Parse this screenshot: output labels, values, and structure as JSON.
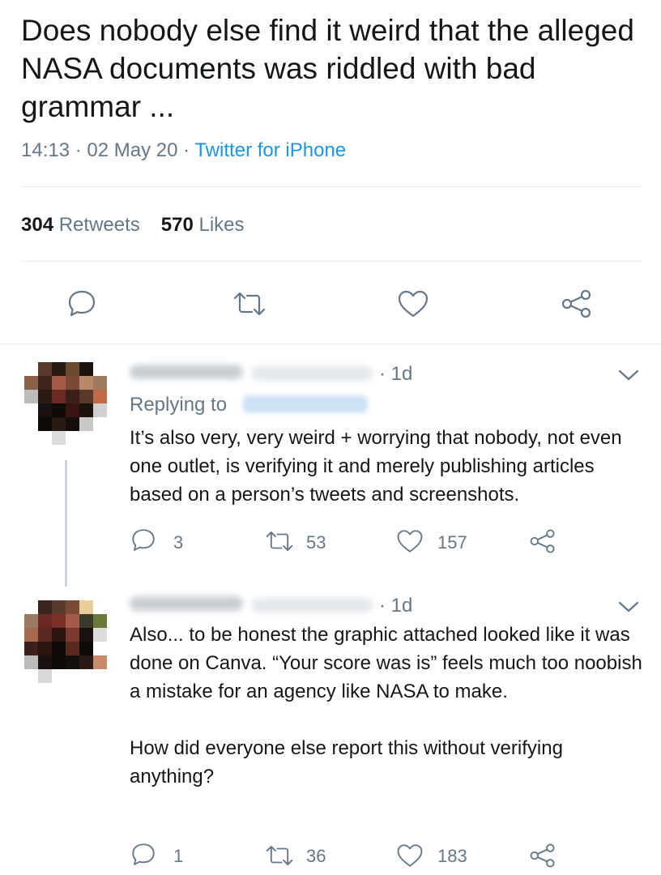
{
  "tweet": {
    "text": "Does nobody else find it weird that the alleged NASA documents was riddled with bad grammar ...",
    "time": "14:13",
    "sep1": "·",
    "date": "02 May 20",
    "sep2": "·",
    "source": "Twitter for iPhone",
    "retweets_count": "304",
    "retweets_label": "Retweets",
    "likes_count": "570",
    "likes_label": "Likes"
  },
  "icons": {
    "reply": "reply-icon",
    "retweet": "retweet-icon",
    "like": "heart-icon",
    "share": "share-icon",
    "more": "chevron-down-icon"
  },
  "replies": [
    {
      "time": "· 1d",
      "replying_to_label": "Replying to",
      "text": "It’s also very, very weird + worrying that nobody, not even one outlet, is verifying it and merely publishing articles based on a person’s tweets and screenshots.",
      "reply_count": "3",
      "retweet_count": "53",
      "like_count": "157"
    },
    {
      "time": "· 1d",
      "text_p1": "Also... to be honest the graphic attached looked like it was done on Canva. “Your score was is” feels much too noobish a mistake for an agency like NASA to make.",
      "text_p2": "How did everyone else report this without verifying anything?",
      "reply_count": "1",
      "retweet_count": "36",
      "like_count": "183"
    }
  ],
  "colors": {
    "text": "#14171a",
    "secondary": "#657786",
    "link": "#1b95e0",
    "divider": "#e6ecf0"
  }
}
